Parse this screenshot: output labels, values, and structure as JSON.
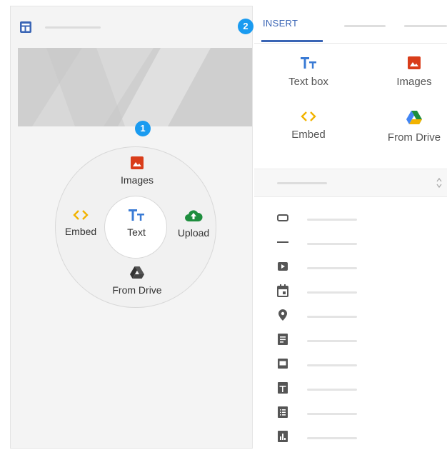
{
  "editor": {
    "layout_icon": "layout-icon",
    "badge_1": "1",
    "wheel": {
      "images_label": "Images",
      "embed_label": "Embed",
      "text_label": "Text",
      "upload_label": "Upload",
      "drive_label": "From Drive"
    }
  },
  "sidebar": {
    "badge_2": "2",
    "tab_insert": "INSERT",
    "insert_items": [
      {
        "label": "Text box",
        "icon": "text-icon"
      },
      {
        "label": "Images",
        "icon": "image-icon"
      },
      {
        "label": "Embed",
        "icon": "embed-icon"
      },
      {
        "label": "From Drive",
        "icon": "drive-icon"
      }
    ],
    "element_icons": [
      "button-icon",
      "divider-icon",
      "youtube-icon",
      "calendar-icon",
      "map-pin-icon",
      "docs-icon",
      "slides-icon",
      "sheets-icon",
      "forms-icon",
      "charts-icon"
    ]
  },
  "colors": {
    "accent_blue": "#3a65b5",
    "badge_blue": "#1a9bf0",
    "image_red": "#d93d1a",
    "embed_yellow": "#f2b300",
    "upload_green": "#1e8e3e",
    "icon_gray": "#616161"
  }
}
